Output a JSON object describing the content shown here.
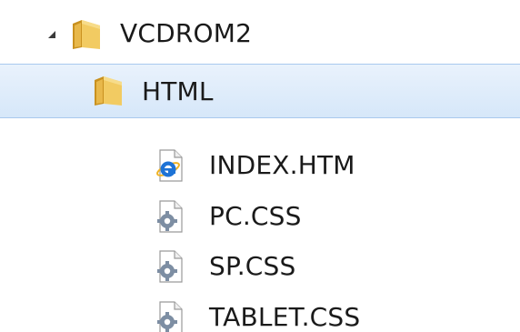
{
  "tree": {
    "root": {
      "label": "VCDROM2",
      "expanded": true,
      "icon": "folder-icon",
      "expander": "expanded-triangle-icon"
    },
    "folder": {
      "label": "HTML",
      "selected": true,
      "icon": "folder-icon"
    },
    "files": [
      {
        "label": "INDEX.HTM",
        "icon": "internet-explorer-document-icon"
      },
      {
        "label": "PC.CSS",
        "icon": "settings-document-icon"
      },
      {
        "label": "SP.CSS",
        "icon": "settings-document-icon"
      },
      {
        "label": "TABLET.CSS",
        "icon": "settings-document-icon"
      }
    ]
  },
  "colors": {
    "selection_top": "#e9f2fc",
    "selection_bottom": "#d6e7f9",
    "selection_border": "#a9c9ee",
    "folder": "#e8b84a",
    "ie_blue": "#1e73d6"
  }
}
